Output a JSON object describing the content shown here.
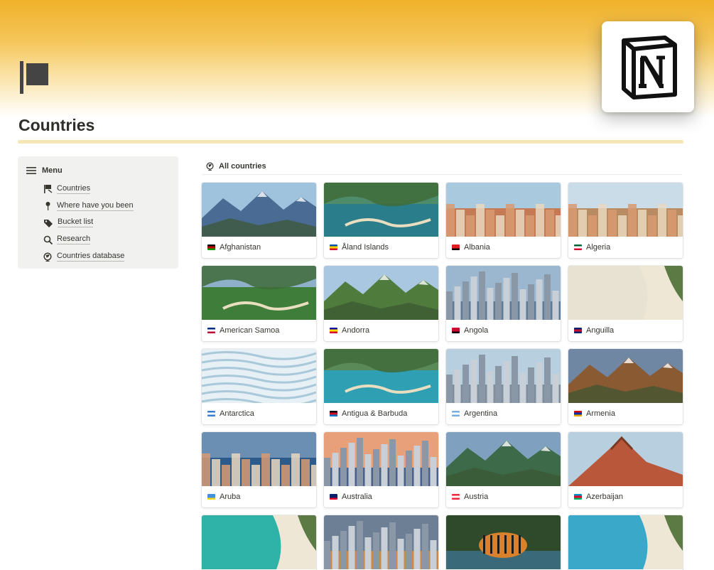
{
  "page": {
    "title": "Countries"
  },
  "menu": {
    "header": "Menu",
    "items": [
      {
        "label": "Countries",
        "icon": "flag-icon"
      },
      {
        "label": "Where have you been",
        "icon": "pin-icon"
      },
      {
        "label": "Bucket list",
        "icon": "tag-icon"
      },
      {
        "label": "Research",
        "icon": "search-icon"
      },
      {
        "label": "Countries database",
        "icon": "globe-icon"
      }
    ]
  },
  "gallery": {
    "view_label": "All countries",
    "cards": [
      {
        "name": "Afghanistan",
        "flag": [
          "#000000",
          "#be0000",
          "#009900"
        ],
        "scene": "mountain",
        "sky": "#9fc3dd",
        "ground": "#4a6b93"
      },
      {
        "name": "Åland Islands",
        "flag": [
          "#0053a5",
          "#ffce00",
          "#d21034"
        ],
        "scene": "coast",
        "sky": "#4e8b6a",
        "ground": "#2a7d8a"
      },
      {
        "name": "Albania",
        "flag": [
          "#e41e20",
          "#e41e20",
          "#000000"
        ],
        "scene": "town",
        "sky": "#a8c9de",
        "ground": "#c47a55"
      },
      {
        "name": "Algeria",
        "flag": [
          "#006233",
          "#ffffff",
          "#d21034"
        ],
        "scene": "town",
        "sky": "#c9dce8",
        "ground": "#b98b62"
      },
      {
        "name": "American Samoa",
        "flag": [
          "#002b7f",
          "#ffffff",
          "#bf0a30"
        ],
        "scene": "coast",
        "sky": "#8fb0c9",
        "ground": "#3e7d3a"
      },
      {
        "name": "Andorra",
        "flag": [
          "#10069f",
          "#fedd00",
          "#d50032"
        ],
        "scene": "mountain",
        "sky": "#a9c7e0",
        "ground": "#4f7c3d"
      },
      {
        "name": "Angola",
        "flag": [
          "#cc092f",
          "#cc092f",
          "#000000"
        ],
        "scene": "city",
        "sky": "#9ab7cf",
        "ground": "#5d7b96"
      },
      {
        "name": "Anguilla",
        "flag": [
          "#012169",
          "#c8102e",
          "#012169"
        ],
        "scene": "beach",
        "sky": "#2fa3b2",
        "ground": "#e8e2d2"
      },
      {
        "name": "Antarctica",
        "flag": [
          "#3a7dce",
          "#ffffff",
          "#3a7dce"
        ],
        "scene": "ice",
        "sky": "#cfe3ee",
        "ground": "#8fb7cf"
      },
      {
        "name": "Antigua & Barbuda",
        "flag": [
          "#000000",
          "#ce1126",
          "#0072c6"
        ],
        "scene": "coast",
        "sky": "#5a8a58",
        "ground": "#2f9fb3"
      },
      {
        "name": "Argentina",
        "flag": [
          "#74acdf",
          "#ffffff",
          "#74acdf"
        ],
        "scene": "city",
        "sky": "#b8cfe0",
        "ground": "#7d8f9e"
      },
      {
        "name": "Armenia",
        "flag": [
          "#d90012",
          "#0033a0",
          "#f2a800"
        ],
        "scene": "mountain",
        "sky": "#6f87a3",
        "ground": "#8a5a33"
      },
      {
        "name": "Aruba",
        "flag": [
          "#418fde",
          "#418fde",
          "#f9d616"
        ],
        "scene": "town",
        "sky": "#6b8fb3",
        "ground": "#2c5a8a"
      },
      {
        "name": "Australia",
        "flag": [
          "#012169",
          "#012169",
          "#e4002b"
        ],
        "scene": "city",
        "sky": "#e8a07a",
        "ground": "#4a5f8a"
      },
      {
        "name": "Austria",
        "flag": [
          "#ed2939",
          "#ffffff",
          "#ed2939"
        ],
        "scene": "mountain",
        "sky": "#7fa1bf",
        "ground": "#3d6b4a"
      },
      {
        "name": "Azerbaijan",
        "flag": [
          "#0092bc",
          "#e4002b",
          "#00af66"
        ],
        "scene": "hills",
        "sky": "#b8cfe0",
        "ground": "#b8573a"
      },
      {
        "name": "",
        "flag": [],
        "scene": "beach",
        "sky": "#4a8fd0",
        "ground": "#2fb3a8"
      },
      {
        "name": "",
        "flag": [],
        "scene": "city",
        "sky": "#6d7f95",
        "ground": "#c78a4a"
      },
      {
        "name": "",
        "flag": [],
        "scene": "tiger",
        "sky": "#2f4a2a",
        "ground": "#3a6a7a"
      },
      {
        "name": "",
        "flag": [],
        "scene": "beach",
        "sky": "#4a8fd0",
        "ground": "#3aa8c9"
      }
    ]
  }
}
